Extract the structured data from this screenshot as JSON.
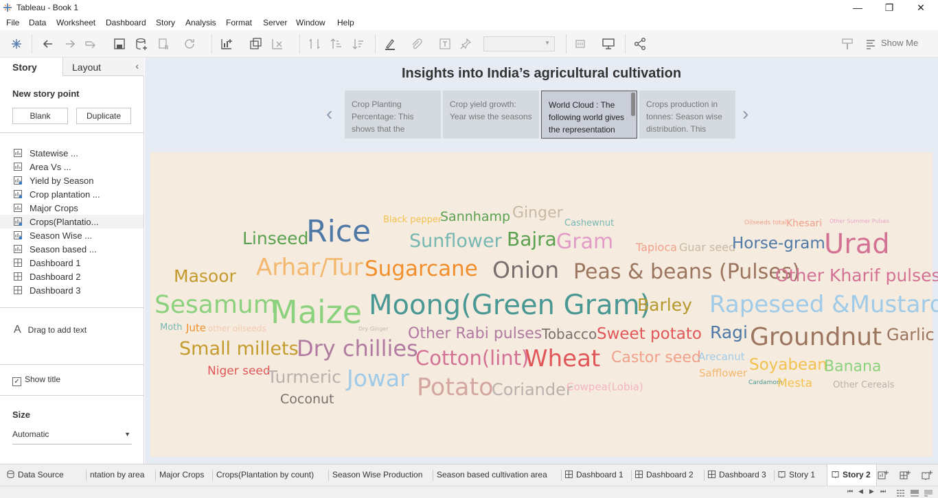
{
  "window": {
    "title": "Tableau - Book 1",
    "minimize": "—",
    "restore": "❐",
    "close": "✕"
  },
  "menu": [
    "File",
    "Data",
    "Worksheet",
    "Dashboard",
    "Story",
    "Analysis",
    "Format",
    "Server",
    "Window",
    "Help"
  ],
  "toolbar": {
    "show_me": "Show Me",
    "icons": [
      "tableau-logo-icon",
      "undo-icon",
      "redo-icon",
      "replay-icon",
      "save-icon",
      "new-datasource-icon",
      "pause-icon",
      "refresh-icon",
      "new-worksheet-icon",
      "duplicate-icon",
      "clear-icon",
      "swap-icon",
      "sort-ascending-icon",
      "sort-descending-icon",
      "highlight-icon",
      "group-icon",
      "labels-icon",
      "pin-icon",
      "fit-icon",
      "presentation-icon",
      "share-icon",
      "format-painter-icon"
    ]
  },
  "left_panel": {
    "tab_story": "Story",
    "tab_layout": "Layout",
    "new_story_point": "New story point",
    "blank_button": "Blank",
    "duplicate_button": "Duplicate",
    "sheets": [
      {
        "name": "Statewise ...",
        "type": "sheet"
      },
      {
        "name": "Area Vs ...",
        "type": "sheet"
      },
      {
        "name": "Yield by Season",
        "type": "sheet-used"
      },
      {
        "name": "Crop plantation ...",
        "type": "sheet-used"
      },
      {
        "name": "Major Crops",
        "type": "sheet"
      },
      {
        "name": "Crops(Plantatio...",
        "type": "sheet-used"
      },
      {
        "name": "Season Wise ...",
        "type": "sheet-used"
      },
      {
        "name": "Season based ...",
        "type": "sheet"
      },
      {
        "name": "Dashboard 1",
        "type": "dashboard"
      },
      {
        "name": "Dashboard 2",
        "type": "dashboard"
      },
      {
        "name": "Dashboard 3",
        "type": "dashboard"
      }
    ],
    "drag_text_glyph": "A",
    "drag_text": "Drag to add text",
    "show_title": "Show title",
    "show_title_checked": "✓",
    "size_label": "Size",
    "size_value": "Automatic"
  },
  "story": {
    "title": "Insights into India’s agricultural cultivation",
    "prev_arrow": "‹",
    "next_arrow": "›",
    "points": [
      {
        "text": "Crop Planting Percentage: This shows that the",
        "active": false
      },
      {
        "text": "Crop yield growth: Year wise the seasons",
        "active": false
      },
      {
        "text": "World Cloud : The following world gives the representation",
        "active": true
      },
      {
        "text": "Crops production in tonnes: Season wise distribution. This",
        "active": false
      }
    ]
  },
  "word_cloud": [
    {
      "text": "Black pepper",
      "color": "#f2c14e"
    },
    {
      "text": "Sannhamp",
      "color": "#59a14f"
    },
    {
      "text": "Ginger",
      "color": "#c9b8a3"
    },
    {
      "text": "Cashewnut",
      "color": "#76b7b2"
    },
    {
      "text": "Oilseeds total",
      "color": "#f1a08a"
    },
    {
      "text": "Khesari",
      "color": "#f1a08a"
    },
    {
      "text": "Other Summer Pulses",
      "color": "#e9a3c9"
    },
    {
      "text": "Linseed",
      "color": "#59a14f"
    },
    {
      "text": "Rice",
      "color": "#4e79a7"
    },
    {
      "text": "Sunflower",
      "color": "#76b7b2"
    },
    {
      "text": "Bajra",
      "color": "#59a14f"
    },
    {
      "text": "Gram",
      "color": "#e19bc6"
    },
    {
      "text": "Tapioca",
      "color": "#f1a08a"
    },
    {
      "text": "Guar seed",
      "color": "#c9b8a3"
    },
    {
      "text": "Horse-gram",
      "color": "#4e79a7"
    },
    {
      "text": "Urad",
      "color": "#d37295"
    },
    {
      "text": "Masoor",
      "color": "#c49a2c"
    },
    {
      "text": "Arhar/Tur",
      "color": "#f4b76e"
    },
    {
      "text": "Sugarcane",
      "color": "#f28e2b"
    },
    {
      "text": "Onion",
      "color": "#79706e"
    },
    {
      "text": "Peas & beans (Pulses)",
      "color": "#9c755f"
    },
    {
      "text": "Other Kharif pulses",
      "color": "#d37295"
    },
    {
      "text": "Sesamum",
      "color": "#8cd17d"
    },
    {
      "text": "Maize",
      "color": "#8cd17d"
    },
    {
      "text": "Moong(Green Gram)",
      "color": "#499894"
    },
    {
      "text": "Barley",
      "color": "#b6992d"
    },
    {
      "text": "Rapeseed &Mustard",
      "color": "#a0cbe8"
    },
    {
      "text": "Moth",
      "color": "#76b7b2"
    },
    {
      "text": "Jute",
      "color": "#f28e2b"
    },
    {
      "text": "other oilseeds",
      "color": "#f4c9b0"
    },
    {
      "text": "Dry Ginger",
      "color": "#c9b8a3"
    },
    {
      "text": "Other Rabi pulses",
      "color": "#b07aa1"
    },
    {
      "text": "Tobacco",
      "color": "#79706e"
    },
    {
      "text": "Sweet potato",
      "color": "#e15759"
    },
    {
      "text": "Ragi",
      "color": "#4e79a7"
    },
    {
      "text": "Groundnut",
      "color": "#9c755f"
    },
    {
      "text": "Garlic",
      "color": "#9c755f"
    },
    {
      "text": "Small millets",
      "color": "#c49a2c"
    },
    {
      "text": "Dry chillies",
      "color": "#b07aa1"
    },
    {
      "text": "Cotton(lint)",
      "color": "#d37295"
    },
    {
      "text": "Wheat",
      "color": "#e15759"
    },
    {
      "text": "Castor seed",
      "color": "#f1a08a"
    },
    {
      "text": "Arecanut",
      "color": "#a0cbe8"
    },
    {
      "text": "Soyabean",
      "color": "#f2c14e"
    },
    {
      "text": "Banana",
      "color": "#8cd17d"
    },
    {
      "text": "Niger seed",
      "color": "#e15759"
    },
    {
      "text": "Turmeric",
      "color": "#bab0ac"
    },
    {
      "text": "Jowar",
      "color": "#a0cbe8"
    },
    {
      "text": "Potato",
      "color": "#d4a6a0"
    },
    {
      "text": "Coriander",
      "color": "#bab0ac"
    },
    {
      "text": "Cowpea(Lobia)",
      "color": "#f4b6c2"
    },
    {
      "text": "Safflower",
      "color": "#f4b76e"
    },
    {
      "text": "Cardamom",
      "color": "#499894"
    },
    {
      "text": "Mesta",
      "color": "#f2c14e"
    },
    {
      "text": "Other Cereals",
      "color": "#bab0ac"
    },
    {
      "text": "Coconut",
      "color": "#79706e"
    }
  ],
  "bottom_tabs": [
    {
      "label": "Data Source",
      "kind": "datasource"
    },
    {
      "label": "ntation by area",
      "kind": "sheet"
    },
    {
      "label": "Major Crops",
      "kind": "sheet"
    },
    {
      "label": "Crops(Plantation by count)",
      "kind": "sheet"
    },
    {
      "label": "Season Wise Production",
      "kind": "sheet"
    },
    {
      "label": "Season based cultivation area",
      "kind": "sheet"
    },
    {
      "label": "Dashboard 1",
      "kind": "dashboard"
    },
    {
      "label": "Dashboard 2",
      "kind": "dashboard"
    },
    {
      "label": "Dashboard 3",
      "kind": "dashboard"
    },
    {
      "label": "Story 1",
      "kind": "story"
    },
    {
      "label": "Story 2",
      "kind": "story-active"
    }
  ],
  "status_nav": [
    "⏮",
    "◀",
    "▶",
    "⏭"
  ]
}
